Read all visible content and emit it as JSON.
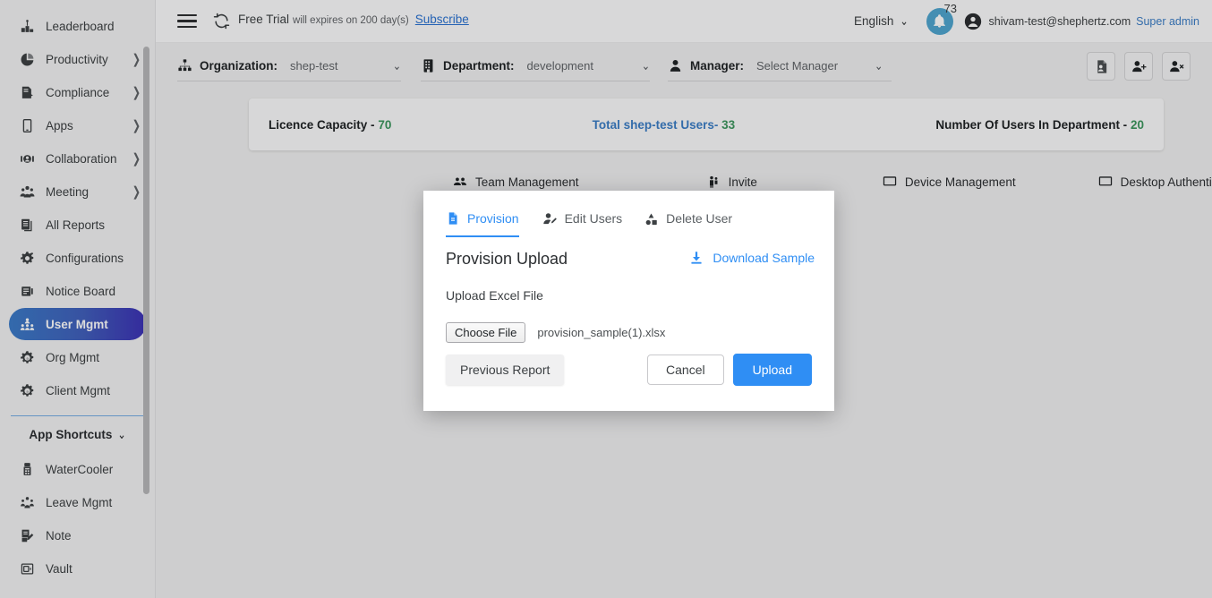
{
  "sidebar": {
    "items": [
      {
        "label": "Leaderboard",
        "icon": "leaderboard-icon",
        "expandable": false,
        "active": false
      },
      {
        "label": "Productivity",
        "icon": "pie-chart-icon",
        "expandable": true,
        "active": false
      },
      {
        "label": "Compliance",
        "icon": "compliance-icon",
        "expandable": true,
        "active": false
      },
      {
        "label": "Apps",
        "icon": "mobile-icon",
        "expandable": true,
        "active": false
      },
      {
        "label": "Collaboration",
        "icon": "collaboration-icon",
        "expandable": true,
        "active": false
      },
      {
        "label": "Meeting",
        "icon": "meeting-icon",
        "expandable": true,
        "active": false
      },
      {
        "label": "All Reports",
        "icon": "reports-icon",
        "expandable": false,
        "active": false
      },
      {
        "label": "Configurations",
        "icon": "gear-icon",
        "expandable": false,
        "active": false
      },
      {
        "label": "Notice Board",
        "icon": "notice-board-icon",
        "expandable": false,
        "active": false
      },
      {
        "label": "User Mgmt",
        "icon": "users-icon",
        "expandable": false,
        "active": true
      },
      {
        "label": "Org Mgmt",
        "icon": "org-gear-icon",
        "expandable": false,
        "active": false
      },
      {
        "label": "Client Mgmt",
        "icon": "client-gear-icon",
        "expandable": false,
        "active": false
      }
    ],
    "shortcuts_label": "App Shortcuts",
    "shortcuts_chevron": "⌄",
    "shortcut_items": [
      {
        "label": "WaterCooler",
        "icon": "watercooler-icon"
      },
      {
        "label": "Leave Mgmt",
        "icon": "leave-mgmt-icon"
      },
      {
        "label": "Note",
        "icon": "note-icon"
      },
      {
        "label": "Vault",
        "icon": "vault-icon"
      }
    ],
    "chevron": "❯"
  },
  "topbar": {
    "hamburger": "hamburger-icon",
    "sync_icon": "sync-icon",
    "trial_strong": "Free Trial",
    "trial_small": "will expires on 200 day(s)",
    "subscribe_label": "Subscribe",
    "language": "English",
    "language_chevron": "⌄",
    "notification_icon": "bell-icon",
    "notification_count": "73",
    "avatar_icon": "avatar-icon",
    "user_email": "shivam-test@shephertz.com",
    "user_role": "Super admin"
  },
  "filters": [
    {
      "label": "Organization:",
      "value": "shep-test",
      "icon": "org-chart-icon",
      "chevron": "⌄"
    },
    {
      "label": "Department:",
      "value": "development",
      "icon": "building-icon",
      "chevron": "⌄"
    },
    {
      "label": "Manager:",
      "value": "Select Manager",
      "icon": "person-icon",
      "chevron": "⌄"
    }
  ],
  "filter_actions": [
    {
      "name": "bulk-upload-report-icon",
      "icon": "file-user-icon"
    },
    {
      "name": "add-user-icon",
      "icon": "user-plus-icon"
    },
    {
      "name": "remove-user-icon",
      "icon": "user-minus-icon"
    }
  ],
  "licence": {
    "capacity_label": "Licence Capacity -",
    "capacity_value": "70",
    "total_users_label": "Total shep-test Users-",
    "total_users_value": "33",
    "dept_users_label": "Number Of Users In Department -",
    "dept_users_value": "20"
  },
  "subtabs": [
    {
      "label": "Team Management",
      "icon": "team-icon"
    },
    {
      "label": "Invite",
      "icon": "invite-icon"
    },
    {
      "label": "Device Management",
      "icon": "monitor-icon"
    },
    {
      "label": "Desktop Authentication",
      "icon": "monitor-icon"
    }
  ],
  "modal": {
    "tabs": [
      {
        "label": "Provision",
        "icon": "file-provision-icon",
        "selected": true
      },
      {
        "label": "Edit Users",
        "icon": "user-edit-icon",
        "selected": false
      },
      {
        "label": "Delete User",
        "icon": "delete-user-icon",
        "selected": false
      }
    ],
    "title": "Provision Upload",
    "download_sample_label": "Download Sample",
    "download_sample_icon": "download-icon",
    "upload_label": "Upload Excel File",
    "choose_file_label": "Choose File",
    "file_name": "provision_sample(1).xlsx",
    "previous_report_label": "Previous Report",
    "cancel_label": "Cancel",
    "upload_button_label": "Upload"
  },
  "colors": {
    "accent_blue": "#2f8ef4",
    "link_blue": "#1a73e8",
    "green": "#2e9b57",
    "sidebar_active_from": "#2f7ddb",
    "sidebar_active_to": "#3d2fd0",
    "bell_blue": "#3fa9dc"
  }
}
